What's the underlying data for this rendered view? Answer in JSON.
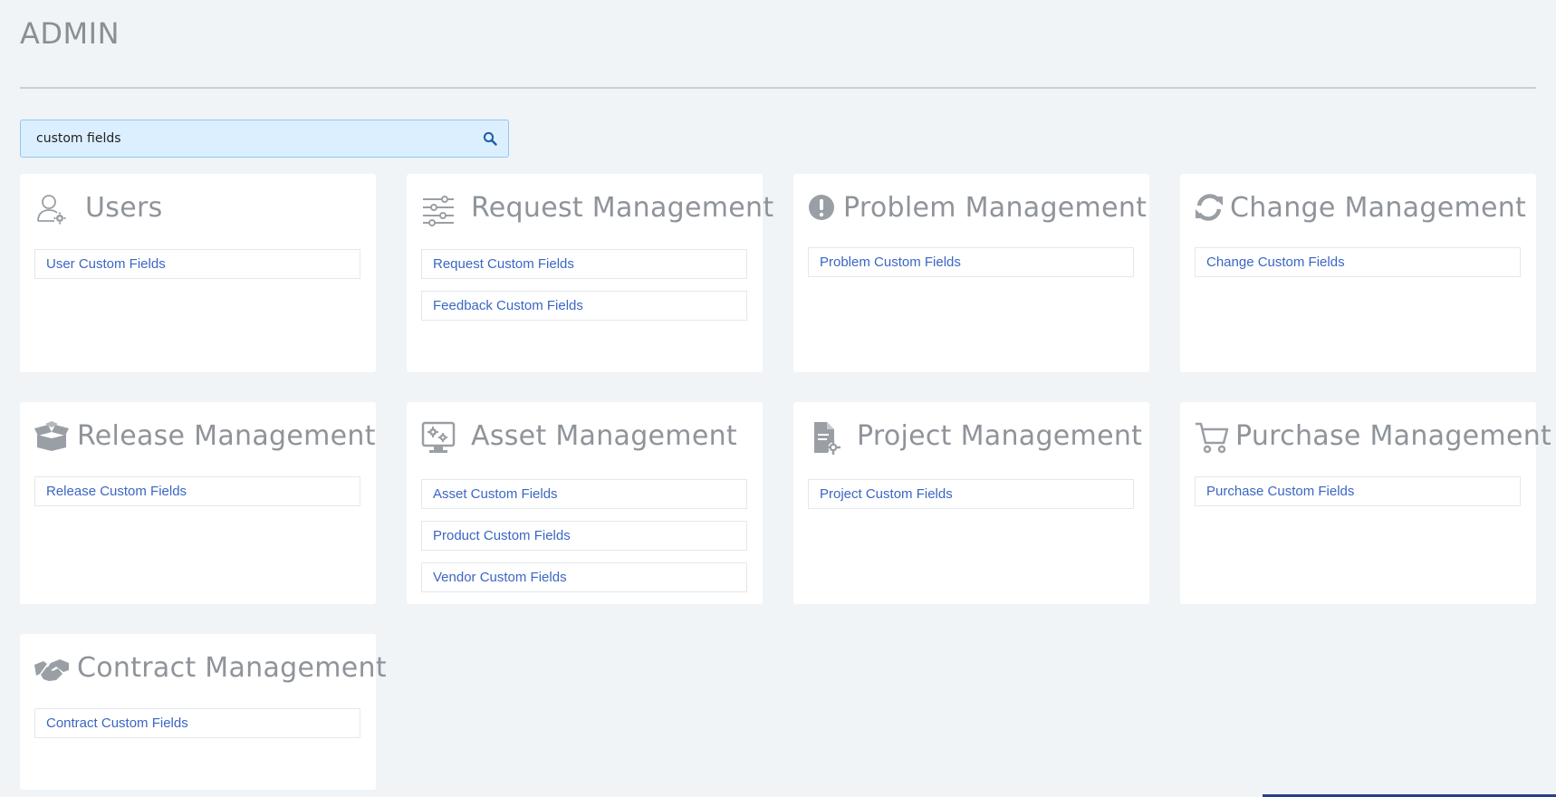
{
  "page": {
    "title": "ADMIN"
  },
  "search": {
    "value": "custom fields",
    "placeholder": ""
  },
  "cards": {
    "users": {
      "title": "Users",
      "links": [
        "User Custom Fields"
      ]
    },
    "request": {
      "title": "Request Management",
      "links": [
        "Request Custom Fields",
        "Feedback Custom Fields"
      ]
    },
    "problem": {
      "title": "Problem Management",
      "links": [
        "Problem Custom Fields"
      ]
    },
    "change": {
      "title": "Change Management",
      "links": [
        "Change Custom Fields"
      ]
    },
    "release": {
      "title": "Release Management",
      "links": [
        "Release Custom Fields"
      ]
    },
    "asset": {
      "title": "Asset Management",
      "links": [
        "Asset Custom Fields",
        "Product Custom Fields",
        "Vendor Custom Fields"
      ]
    },
    "project": {
      "title": "Project Management",
      "links": [
        "Project Custom Fields"
      ]
    },
    "purchase": {
      "title": "Purchase Management",
      "links": [
        "Purchase Custom Fields"
      ]
    },
    "contract": {
      "title": "Contract Management",
      "links": [
        "Contract Custom Fields"
      ]
    }
  },
  "icons": {
    "users": "user-gear-icon",
    "request": "sliders-icon",
    "problem": "exclamation-circle-icon",
    "change": "refresh-icon",
    "release": "open-box-icon",
    "asset": "monitor-gears-icon",
    "project": "document-gear-icon",
    "purchase": "shopping-cart-icon",
    "contract": "handshake-icon",
    "search": "search-icon"
  },
  "colors": {
    "link": "#3b66c4",
    "title": "#8f949a",
    "search_bg": "#dcefff",
    "search_border": "#8fc8ee",
    "background": "#f0f4f7"
  }
}
